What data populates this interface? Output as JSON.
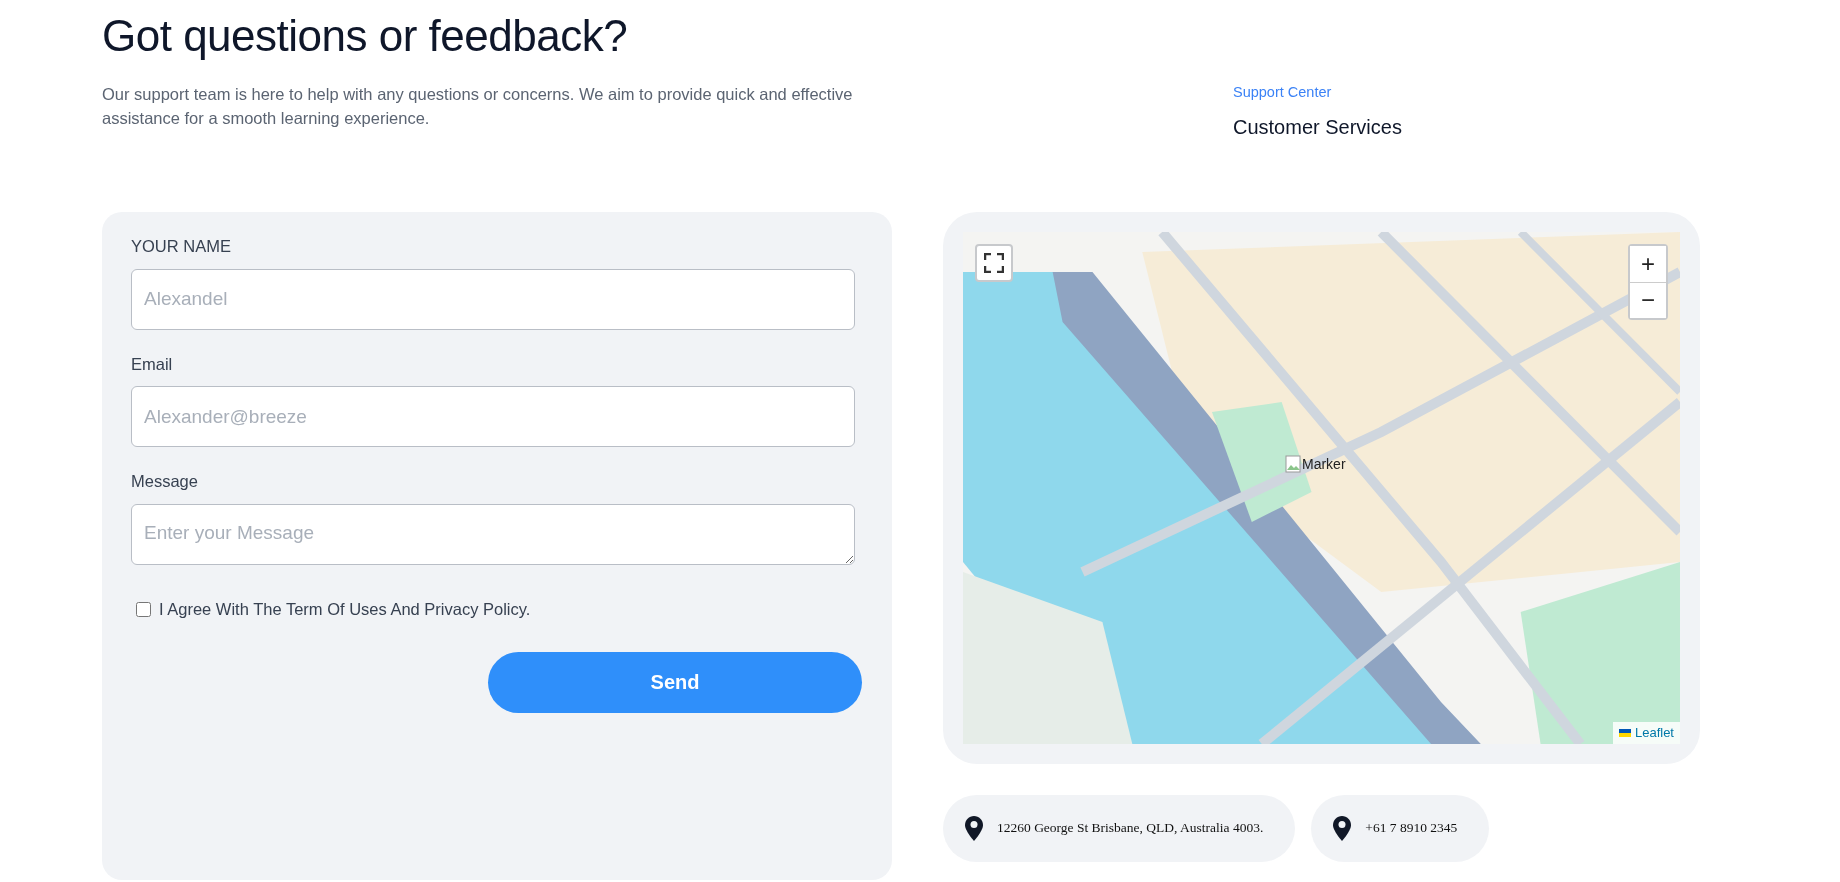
{
  "header": {
    "title": "Got questions or feedback?",
    "description": "Our support team is here to help with any questions or concerns. We aim to provide quick and effective assistance for a smooth learning experience.",
    "eyebrow": "Support Center",
    "subtitle": "Customer Services"
  },
  "form": {
    "fields": [
      {
        "kind": "input",
        "label": "YOUR NAME",
        "placeholder": "Alexandel"
      },
      {
        "kind": "input",
        "label": "Email",
        "placeholder": "Alexander@breeze"
      },
      {
        "kind": "textarea",
        "label": "Message",
        "placeholder": "Enter your Message"
      }
    ],
    "agree": {
      "label": "I Agree With The Term Of Uses And Privacy Policy.",
      "checked": false
    },
    "submit": "Send"
  },
  "map": {
    "zoom_in": "+",
    "zoom_out": "−",
    "marker": "Marker",
    "attribution": "Leaflet"
  },
  "contacts": [
    {
      "text": "12260 George St Brisbane, QLD, Australia 4003."
    },
    {
      "text": "+61 7 8910 2345"
    }
  ]
}
